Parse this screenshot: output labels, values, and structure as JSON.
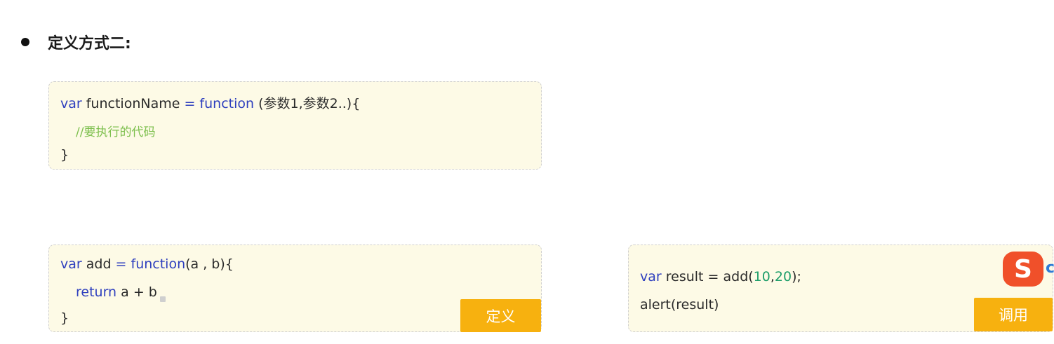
{
  "heading": "定义方式二:",
  "box1": {
    "line1": {
      "kw1": "var",
      "name": " functionName ",
      "eq": "=",
      "kw2": " function",
      "rest": " (参数1,参数2..){"
    },
    "comment": "//要执行的代码",
    "close": "}"
  },
  "box2": {
    "line1": {
      "kw1": "var",
      "name": " add ",
      "eq": "=",
      "kw2": " function",
      "rest": "(a , b){"
    },
    "line2": {
      "kw": "return",
      "expr": " a + b"
    },
    "close": "}",
    "tag": "定义"
  },
  "box3": {
    "line1": {
      "kw": "var",
      "mid": " result = add(",
      "n1": "10",
      "comma": ",",
      "n2": "20",
      "end": ");"
    },
    "line2": "alert(result)",
    "tag": "调用"
  },
  "sogou": {
    "glyph": "S",
    "extra": "c"
  },
  "colors": {
    "keyword": "#2e3fbe",
    "number": "#1e9e6a",
    "comment": "#7cbf4c",
    "tag": "#f7b10f",
    "box_bg": "#fdfae6"
  }
}
